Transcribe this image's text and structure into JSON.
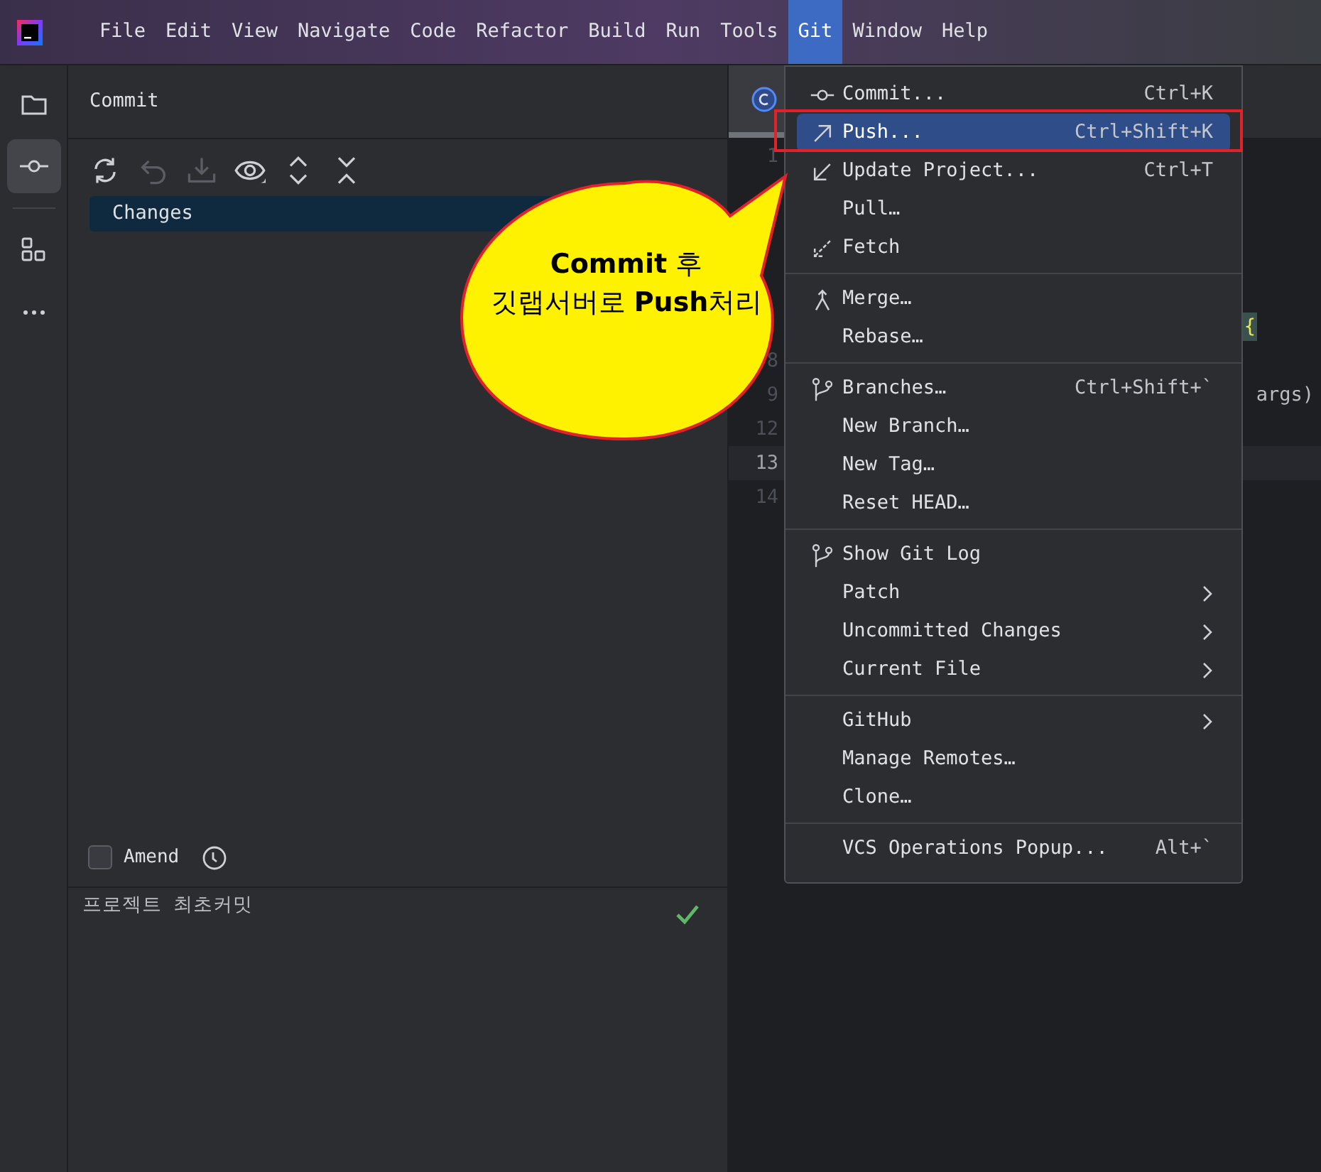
{
  "menu_bar": [
    {
      "label": "File",
      "selected": false
    },
    {
      "label": "Edit",
      "selected": false
    },
    {
      "label": "View",
      "selected": false
    },
    {
      "label": "Navigate",
      "selected": false
    },
    {
      "label": "Code",
      "selected": false
    },
    {
      "label": "Refactor",
      "selected": false
    },
    {
      "label": "Build",
      "selected": false
    },
    {
      "label": "Run",
      "selected": false
    },
    {
      "label": "Tools",
      "selected": false
    },
    {
      "label": "Git",
      "selected": true
    },
    {
      "label": "Window",
      "selected": false
    },
    {
      "label": "Help",
      "selected": false
    }
  ],
  "tool_strip": [
    {
      "kind": "folder",
      "selected": false
    },
    {
      "kind": "commit",
      "selected": true
    },
    {
      "kind": "structure",
      "selected": false
    },
    {
      "kind": "more",
      "selected": false
    }
  ],
  "commit_panel": {
    "title": "Commit",
    "toolbar": [
      {
        "kind": "refresh",
        "disabled": false
      },
      {
        "kind": "undo",
        "disabled": true
      },
      {
        "kind": "download",
        "disabled": true
      },
      {
        "kind": "eye",
        "disabled": false
      },
      {
        "kind": "expand",
        "disabled": false
      },
      {
        "kind": "collapse",
        "disabled": false
      }
    ],
    "tree": [
      {
        "label": "Changes",
        "selected": true
      }
    ],
    "amend": {
      "label": "Amend",
      "checked": false
    },
    "message": "프로젝트 최초커밋"
  },
  "editor": {
    "rows": [
      {
        "kind": "line",
        "number": "1",
        "current": false
      },
      {
        "kind": "blank"
      },
      {
        "kind": "blank"
      },
      {
        "kind": "blank"
      },
      {
        "kind": "blank"
      },
      {
        "kind": "code",
        "code": "{"
      },
      {
        "kind": "line",
        "number": "8",
        "current": false
      },
      {
        "kind": "line",
        "number": "9",
        "current": false,
        "code": "args)"
      },
      {
        "kind": "line",
        "number": "12",
        "current": false
      },
      {
        "kind": "line",
        "number": "13",
        "current": true
      },
      {
        "kind": "line",
        "number": "14",
        "current": false
      }
    ]
  },
  "git_menu": {
    "groups": [
      [
        {
          "label": "Commit...",
          "shortcut": "Ctrl+K",
          "kind": "commit",
          "selected": false,
          "submenu": false
        },
        {
          "label": "Push...",
          "shortcut": "Ctrl+Shift+K",
          "kind": "push",
          "selected": true,
          "submenu": false
        },
        {
          "label": "Update Project...",
          "shortcut": "Ctrl+T",
          "kind": "update",
          "selected": false,
          "submenu": false
        },
        {
          "label": "Pull…",
          "selected": false,
          "submenu": false
        },
        {
          "label": "Fetch",
          "kind": "fetch",
          "selected": false,
          "submenu": false
        }
      ],
      [
        {
          "label": "Merge…",
          "kind": "merge",
          "selected": false,
          "submenu": false
        },
        {
          "label": "Rebase…",
          "selected": false,
          "submenu": false
        }
      ],
      [
        {
          "label": "Branches…",
          "shortcut": "Ctrl+Shift+`",
          "kind": "branches",
          "selected": false,
          "submenu": false
        },
        {
          "label": "New Branch…",
          "selected": false,
          "submenu": false
        },
        {
          "label": "New Tag…",
          "selected": false,
          "submenu": false
        },
        {
          "label": "Reset HEAD…",
          "selected": false,
          "submenu": false
        }
      ],
      [
        {
          "label": "Show Git Log",
          "kind": "branches",
          "selected": false,
          "submenu": false
        },
        {
          "label": "Patch",
          "selected": false,
          "submenu": true
        },
        {
          "label": "Uncommitted Changes",
          "selected": false,
          "submenu": true
        },
        {
          "label": "Current File",
          "selected": false,
          "submenu": true
        }
      ],
      [
        {
          "label": "GitHub",
          "selected": false,
          "submenu": true
        },
        {
          "label": "Manage Remotes…",
          "selected": false,
          "submenu": false
        },
        {
          "label": "Clone…",
          "selected": false,
          "submenu": false
        }
      ],
      [
        {
          "label": "VCS Operations Popup...",
          "shortcut": "Alt+`",
          "selected": false,
          "submenu": false
        }
      ]
    ]
  },
  "callout": {
    "lines": [
      "**Commit** 후",
      "깃랩서버로 **Push**처리"
    ]
  }
}
